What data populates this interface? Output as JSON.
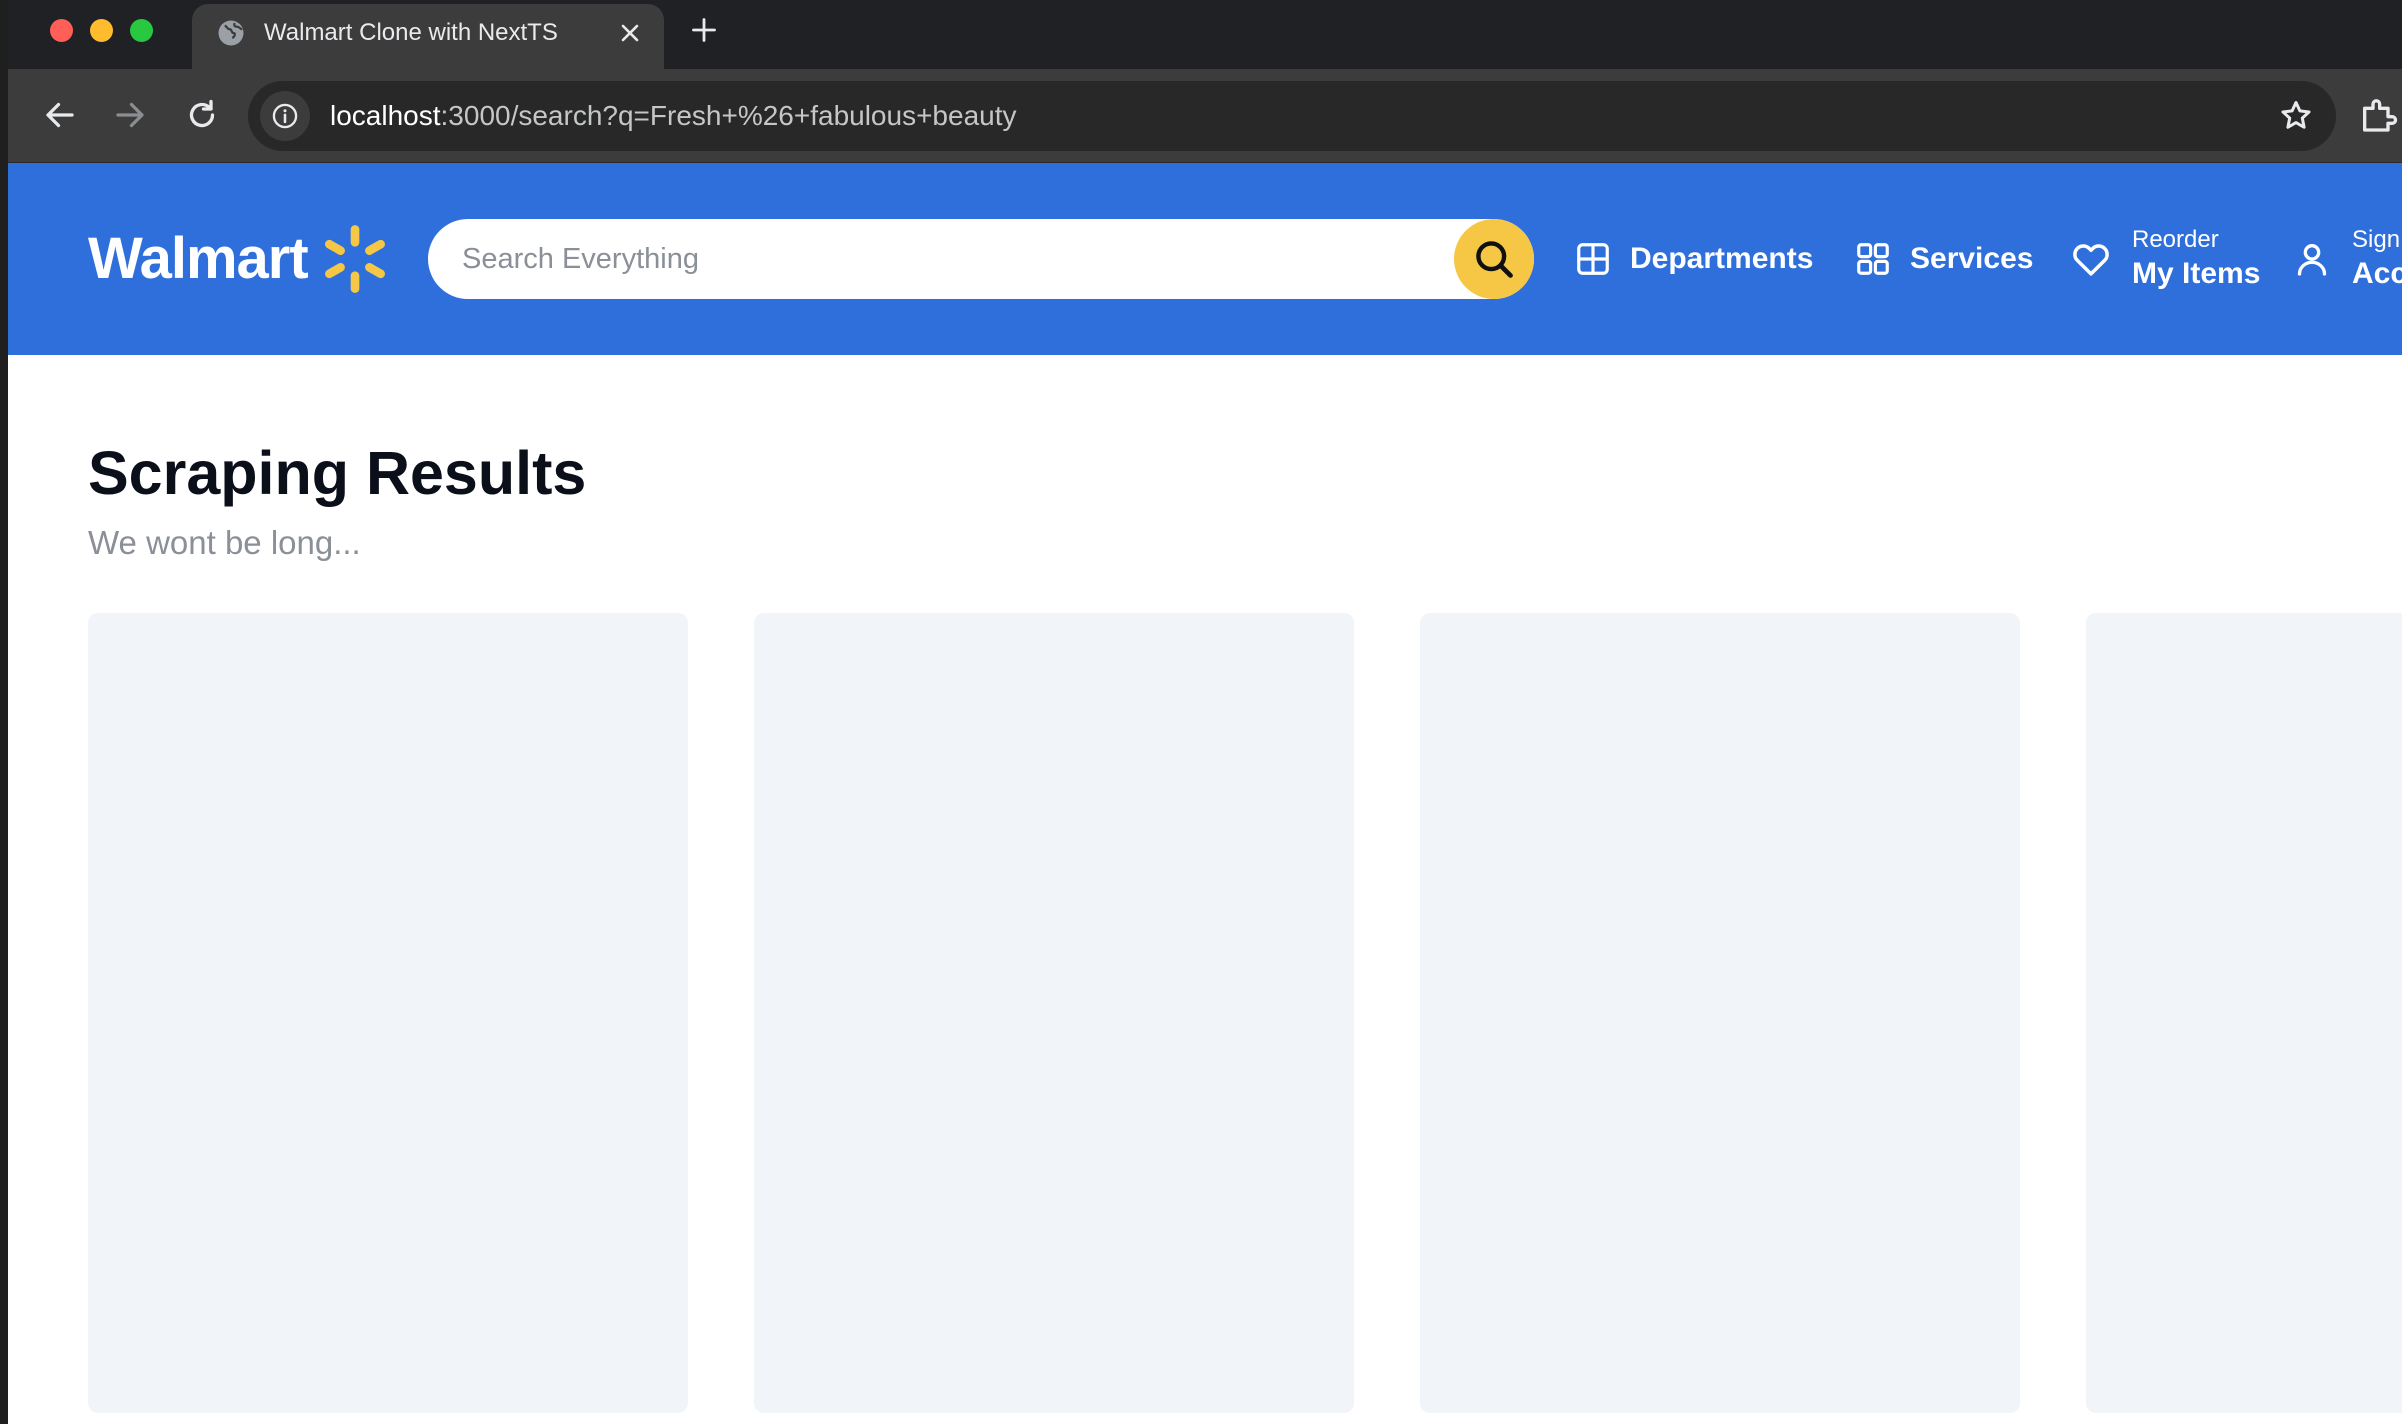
{
  "browser": {
    "tab_title": "Walmart Clone with NextTS",
    "url_host": "localhost",
    "url_rest": ":3000/search?q=Fresh+%26+fabulous+beauty"
  },
  "header": {
    "logo_text": "Walmart",
    "search_placeholder": "Search Everything",
    "search_value": "",
    "nav": {
      "departments": "Departments",
      "services": "Services",
      "reorder_top": "Reorder",
      "reorder_bottom": "My Items",
      "account_top": "Sign In",
      "account_bottom": "Account"
    }
  },
  "main": {
    "title": "Scraping Results",
    "subtitle": "We wont be long..."
  },
  "colors": {
    "header_bg": "#2f6fdc",
    "spark": "#f6c744",
    "search_button": "#f6c744",
    "skeleton": "#f1f4f9"
  },
  "icons": {
    "tab": "globe-icon",
    "search": "search-icon",
    "departments": "grid-icon",
    "services": "apps-icon",
    "reorder": "heart-icon",
    "account": "user-icon"
  }
}
